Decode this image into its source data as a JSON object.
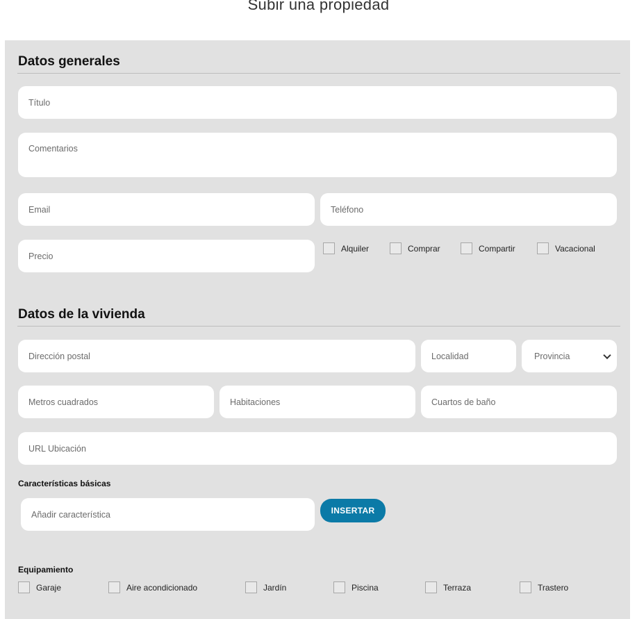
{
  "page_title": "Subir una propiedad",
  "general": {
    "title": "Datos generales",
    "titulo_placeholder": "Título",
    "comentarios_placeholder": "Comentarios",
    "email_placeholder": "Email",
    "telefono_placeholder": "Teléfono",
    "precio_placeholder": "Precio",
    "operation_types": [
      "Alquiler",
      "Comprar",
      "Compartir",
      "Vacacional"
    ]
  },
  "vivienda": {
    "title": "Datos de la vivienda",
    "direccion_placeholder": "Dirección postal",
    "localidad_placeholder": "Localidad",
    "provincia_selected": "Provincia",
    "metros_placeholder": "Metros cuadrados",
    "habitaciones_placeholder": "Habitaciones",
    "banos_placeholder": "Cuartos de baño",
    "url_placeholder": "URL Ubicación"
  },
  "caracteristicas": {
    "label": "Características básicas",
    "input_placeholder": "Añadir característica",
    "insert_label": "INSERTAR"
  },
  "equipamiento": {
    "label": "Equipamiento",
    "items": [
      "Garaje",
      "Aire acondicionado",
      "Jardín",
      "Piscina",
      "Terraza",
      "Trastero"
    ]
  },
  "colors": {
    "panel_bg": "#e1e1e1",
    "button_bg": "#0b7aa7",
    "field_bg": "#ffffff"
  }
}
